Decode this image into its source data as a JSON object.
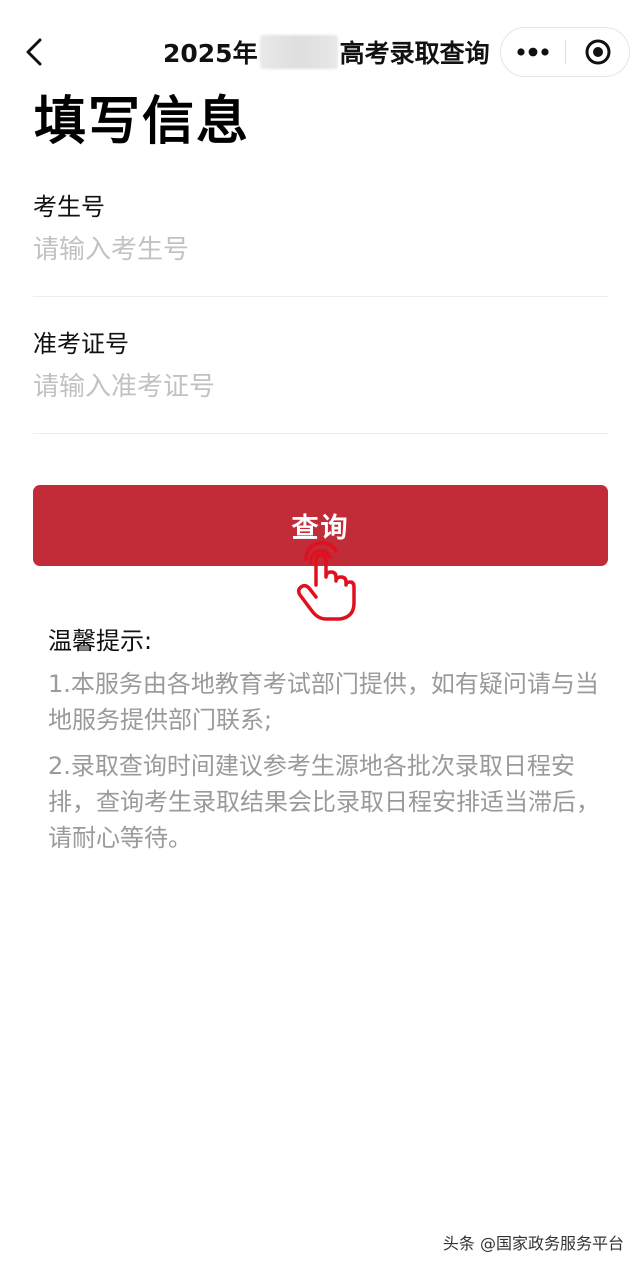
{
  "nav": {
    "title_prefix": "2025年",
    "title_suffix": "高考录取查询",
    "back_icon": "chevron-left-icon",
    "more_icon": "more-dots-icon",
    "close_icon": "target-close-icon"
  },
  "page": {
    "title": "填写信息"
  },
  "form": {
    "exam_number": {
      "label": "考生号",
      "placeholder": "请输入考生号",
      "value": ""
    },
    "admission_ticket": {
      "label": "准考证号",
      "placeholder": "请输入准考证号",
      "value": ""
    },
    "submit_label": "查询"
  },
  "tips": {
    "title": "温馨提示:",
    "items": [
      "1.本服务由各地教育考试部门提供，如有疑问请与当地服务提供部门联系;",
      "2.录取查询时间建议参考生源地各批次录取日程安排，查询考生录取结果会比录取日程安排适当滞后，请耐心等待。"
    ]
  },
  "watermark": "头条 @国家政务服务平台",
  "colors": {
    "primary": "#c22b38",
    "hand_cursor": "#e0101e",
    "placeholder": "#c2c2c2",
    "tip_text": "#9a9a9a"
  }
}
